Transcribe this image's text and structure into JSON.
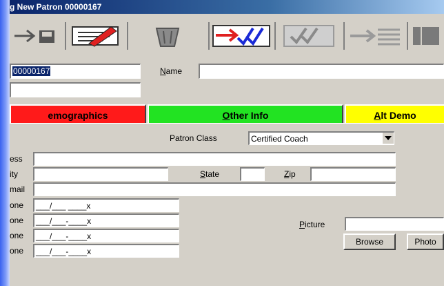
{
  "window": {
    "title": "g New Patron 00000167"
  },
  "toolbar": {
    "buttons": [
      {
        "icon": "save-arrow-icon"
      },
      {
        "icon": "edit-pencil-icon"
      },
      {
        "icon": "trash-icon"
      },
      {
        "icon": "checkmarks-red-arrow-icon"
      },
      {
        "icon": "checkmarks-gray-icon"
      },
      {
        "icon": "list-arrow-icon"
      },
      {
        "icon": "grid-icon"
      }
    ]
  },
  "patron": {
    "barcode": "00000167",
    "name_label": "Name",
    "name_value": "",
    "second_value": ""
  },
  "tabs": [
    {
      "label": "emographics",
      "color": "#ff1a1a",
      "active": true
    },
    {
      "label": "Other Info",
      "accel": "O",
      "color": "#22e322",
      "active": false
    },
    {
      "label": "Alt Demo",
      "accel": "A",
      "color": "#ffff00",
      "active": false
    }
  ],
  "form": {
    "patron_class_label": "Patron Class",
    "patron_class_value": "Certified Coach",
    "address_label": "ess",
    "city_label": "ity",
    "state_label": "State",
    "zip_label": "Zip",
    "email_label": "mail",
    "phones": [
      {
        "label": "one",
        "mask": "___/___ ____x"
      },
      {
        "label": "one",
        "mask": "___/___-____x"
      },
      {
        "label": "one",
        "mask": "___/___-____x"
      },
      {
        "label": "one",
        "mask": "___/___-____x"
      }
    ],
    "picture_label": "Picture",
    "browse_label": "Browse",
    "photo_label": "Photo"
  },
  "colors": {
    "desktop": "#2a44d6",
    "window": "#d4d0c8",
    "title": "#0a246a"
  }
}
